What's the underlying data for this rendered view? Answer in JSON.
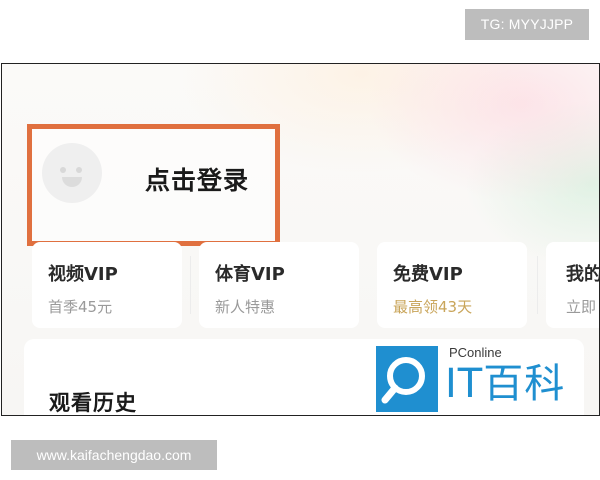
{
  "watermarks": {
    "top": "TG: MYYJJPP",
    "bottom": "www.kaifachengdao.com"
  },
  "login": {
    "label": "点击登录"
  },
  "vip_cards": [
    {
      "title": "视频VIP",
      "subtitle": "首季45元"
    },
    {
      "title": "体育VIP",
      "subtitle": "新人特惠"
    },
    {
      "title": "免费VIP",
      "subtitle": "最高领43天"
    },
    {
      "title": "我的",
      "subtitle": "立即"
    }
  ],
  "history": {
    "title": "观看历史"
  },
  "logo": {
    "brand": "PConline",
    "name": "IT百科"
  },
  "colors": {
    "highlight_border": "#e0703f",
    "logo_blue": "#1f8fd0",
    "gold_text": "#c9a55a"
  }
}
